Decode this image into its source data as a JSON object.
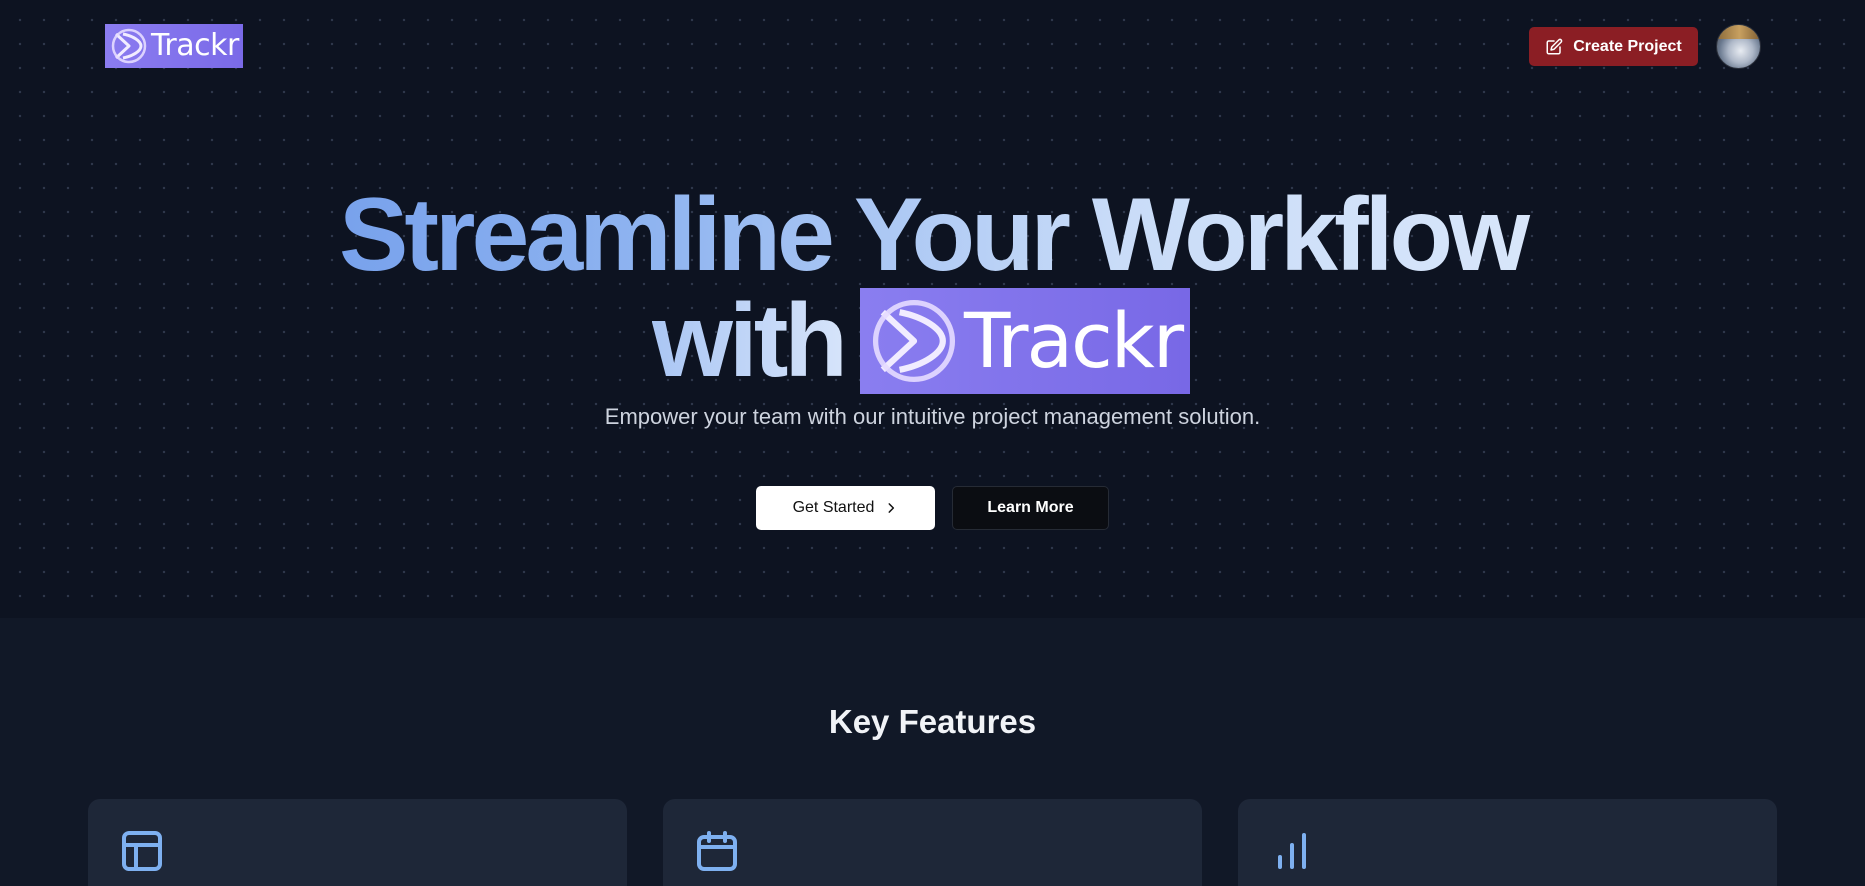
{
  "header": {
    "logo_text": "Trackr",
    "create_button_label": "Create Project"
  },
  "hero": {
    "headline_line1": "Streamline Your Workflow",
    "headline_with": "with",
    "headline_logo_text": "Trackr",
    "subtitle": "Empower your team with our intuitive project management solution.",
    "get_started_label": "Get Started",
    "learn_more_label": "Learn More"
  },
  "features": {
    "title": "Key Features",
    "cards": [
      {
        "icon": "layout-icon"
      },
      {
        "icon": "calendar-icon"
      },
      {
        "icon": "bar-chart-icon"
      }
    ]
  },
  "colors": {
    "logo_bg": "#7a6ae8",
    "create_button": "#8b1e24",
    "hero_bg": "#0d1321",
    "section_bg": "#111827",
    "card_bg": "#1e2738",
    "icon_blue": "#7eb0f0"
  }
}
